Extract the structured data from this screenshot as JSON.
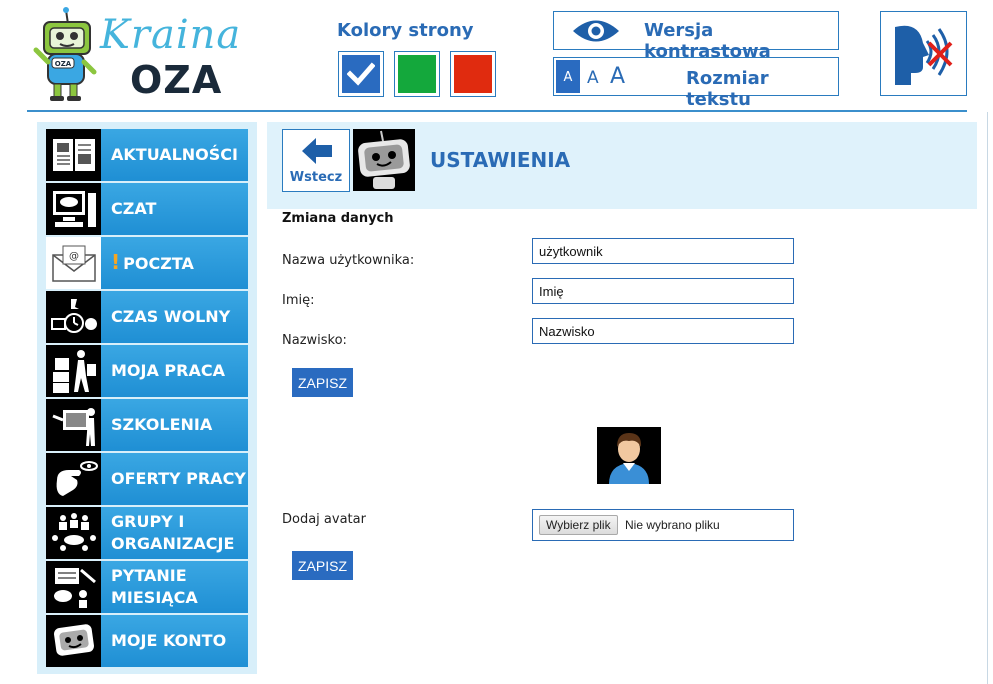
{
  "logo": {
    "kraina": "Kraina",
    "oza": "OZA",
    "badge": "OZA"
  },
  "header": {
    "colors_title": "Kolory strony",
    "color_options": [
      {
        "name": "blue",
        "color": "#2a6bc0",
        "selected": true
      },
      {
        "name": "green",
        "color": "#14a83c",
        "selected": false
      },
      {
        "name": "red",
        "color": "#e02b0f",
        "selected": false
      }
    ],
    "contrast_label": "Wersja kontrastowa",
    "text_size_label": "Rozmiar tekstu",
    "text_size_options": [
      "A",
      "A",
      "A"
    ],
    "speech_icon": "speech-off-icon"
  },
  "sidebar": {
    "items": [
      {
        "label": "AKTUALNOŚCI",
        "icon": "newspaper-icon"
      },
      {
        "label": "CZAT",
        "icon": "computer-chat-icon"
      },
      {
        "label": "POCZTA",
        "icon": "envelope-icon",
        "alert": "!"
      },
      {
        "label": "CZAS WOLNY",
        "icon": "leisure-icon"
      },
      {
        "label": "MOJA PRACA",
        "icon": "work-boxes-icon"
      },
      {
        "label": "SZKOLENIA",
        "icon": "training-icon"
      },
      {
        "label": "OFERTY PRACY",
        "icon": "job-offers-icon"
      },
      {
        "label": "GRUPY I ORGANIZACJE",
        "line1": "GRUPY I",
        "line2": "ORGANIZACJE",
        "icon": "groups-icon"
      },
      {
        "label": "PYTANIE MIESIĄCA",
        "line1": "PYTANIE",
        "line2": "MIESIĄCA",
        "icon": "question-icon"
      },
      {
        "label": "MOJE KONTO",
        "icon": "robot-account-icon"
      }
    ]
  },
  "main": {
    "back_label": "Wstecz",
    "title": "USTAWIENIA",
    "section_title": "Zmiana danych",
    "fields": {
      "username": {
        "label": "Nazwa użytkownika:",
        "value": "użytkownik"
      },
      "first_name": {
        "label": "Imię:",
        "value": "Imię"
      },
      "last_name": {
        "label": "Nazwisko:",
        "value": "Nazwisko"
      }
    },
    "save_label": "ZAPISZ",
    "avatar_label": "Dodaj avatar",
    "file_button": "Wybierz plik",
    "file_status": "Nie wybrano pliku",
    "save_label_2": "ZAPISZ"
  }
}
